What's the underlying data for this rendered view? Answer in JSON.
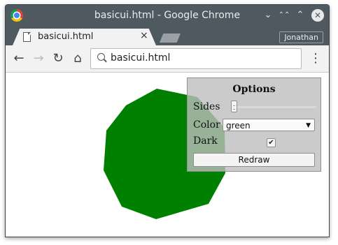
{
  "window": {
    "title": "basicui.html - Google Chrome",
    "buttons": {
      "minimize": "⌄",
      "maximize": "⌃⌃",
      "restore": "⌃",
      "close": "✕"
    }
  },
  "tab": {
    "label": "basicui.html",
    "close": "×"
  },
  "profile": {
    "name": "Jonathan"
  },
  "toolbar": {
    "back": "←",
    "forward": "→",
    "reload": "↻",
    "home": "⌂",
    "url": "basicui.html",
    "menu": "⋮"
  },
  "shape": {
    "color": "#008000",
    "sides": 10
  },
  "options": {
    "title": "Options",
    "sides_label": "Sides",
    "sides_level": 0.02,
    "color_label": "Color",
    "color_value": "green",
    "color_arrow": "▼",
    "dark_label": "Dark",
    "dark_checked": true,
    "dark_check_glyph": "✔",
    "redraw_label": "Redraw"
  }
}
